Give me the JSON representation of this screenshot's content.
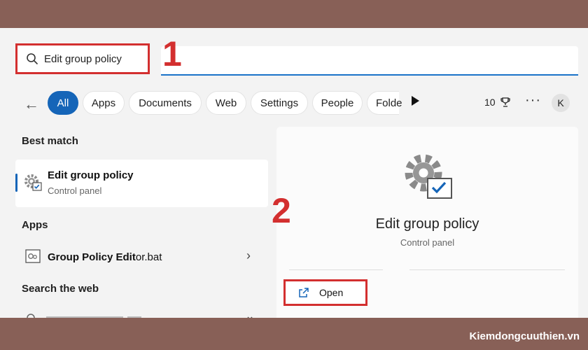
{
  "search": {
    "query": "Edit group policy"
  },
  "steps": [
    "1",
    "2"
  ],
  "filters": {
    "chips": [
      "All",
      "Apps",
      "Documents",
      "Web",
      "Settings",
      "People",
      "Folde"
    ],
    "points": "10",
    "avatar": "K"
  },
  "sections": {
    "best_match": "Best match",
    "apps": "Apps",
    "search_web": "Search the web"
  },
  "best_match": {
    "title": "Edit group policy",
    "subtitle": "Control panel"
  },
  "apps": [
    {
      "label_bold": "Group Policy Edit",
      "label_rest": "or.bat"
    }
  ],
  "detail": {
    "title": "Edit group policy",
    "subtitle": "Control panel",
    "open_label": "Open"
  },
  "watermark": "Kiemdongcuuthien.vn",
  "colors": {
    "accent": "#1565b8",
    "highlight": "#d32f2f",
    "frame": "#886057"
  }
}
